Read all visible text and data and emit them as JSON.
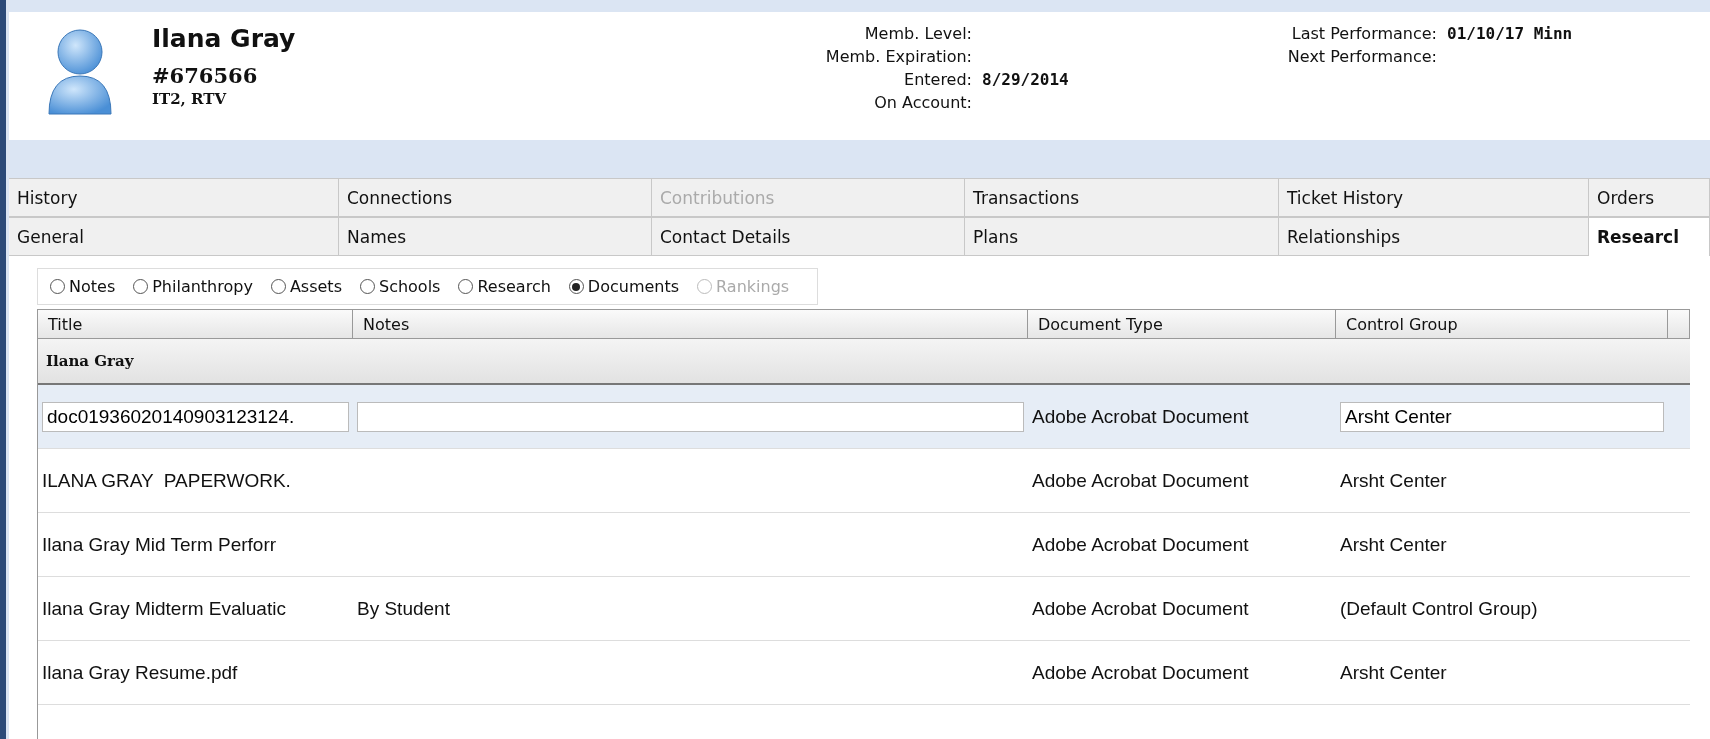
{
  "profile": {
    "name": "Ilana Gray",
    "number": "#676566",
    "codes": "IT2, RTV"
  },
  "fields_middle": [
    {
      "label": "Memb. Level:"
    },
    {
      "label": "Memb. Expiration:"
    },
    {
      "label": "Entered:",
      "value": "8/29/2014"
    },
    {
      "label": "On Account:"
    }
  ],
  "fields_right": [
    {
      "label": "Last Performance:",
      "value": "01/10/17 Minn"
    },
    {
      "label": "Next Performance:"
    }
  ],
  "tab_rows": [
    [
      {
        "label": "History",
        "selected": false,
        "disabled": false
      },
      {
        "label": "Connections",
        "selected": false,
        "disabled": false
      },
      {
        "label": "Contributions",
        "selected": false,
        "disabled": true
      },
      {
        "label": "Transactions",
        "selected": false,
        "disabled": false
      },
      {
        "label": "Ticket History",
        "selected": false,
        "disabled": false
      },
      {
        "label": "Orders",
        "selected": false,
        "disabled": false
      }
    ],
    [
      {
        "label": "General",
        "selected": false,
        "disabled": false
      },
      {
        "label": "Names",
        "selected": false,
        "disabled": false
      },
      {
        "label": "Contact Details",
        "selected": false,
        "disabled": false
      },
      {
        "label": "Plans",
        "selected": false,
        "disabled": false
      },
      {
        "label": "Relationships",
        "selected": false,
        "disabled": false
      },
      {
        "label": "Researcl",
        "selected": true,
        "disabled": false
      }
    ]
  ],
  "radios": [
    {
      "label": "Notes",
      "selected": false,
      "disabled": false
    },
    {
      "label": "Philanthropy",
      "selected": false,
      "disabled": false
    },
    {
      "label": "Assets",
      "selected": false,
      "disabled": false
    },
    {
      "label": "Schools",
      "selected": false,
      "disabled": false
    },
    {
      "label": "Research",
      "selected": false,
      "disabled": false
    },
    {
      "label": "Documents",
      "selected": true,
      "disabled": false
    },
    {
      "label": "Rankings",
      "selected": false,
      "disabled": true
    }
  ],
  "table": {
    "columns": [
      "Title",
      "Notes",
      "Document Type",
      "Control Group"
    ],
    "group": "Ilana Gray",
    "rows": [
      {
        "title": "doc01936020140903123124.",
        "type": "Adobe Acrobat Document",
        "control_group": "Arsht Center",
        "editing": true
      },
      {
        "title": "ILANA GRAY  PAPERWORK.",
        "type": "Adobe Acrobat Document",
        "control_group": "Arsht Center",
        "editing": false
      },
      {
        "title": "Ilana Gray Mid Term Perforr",
        "type": "Adobe Acrobat Document",
        "control_group": "Arsht Center",
        "editing": false
      },
      {
        "title": "Ilana Gray Midterm Evaluatic",
        "notes": "By Student",
        "type": "Adobe Acrobat Document",
        "control_group": "(Default Control Group)",
        "editing": false
      },
      {
        "title": "Ilana Gray Resume.pdf",
        "type": "Adobe Acrobat Document",
        "control_group": "Arsht Center",
        "editing": false
      }
    ]
  }
}
